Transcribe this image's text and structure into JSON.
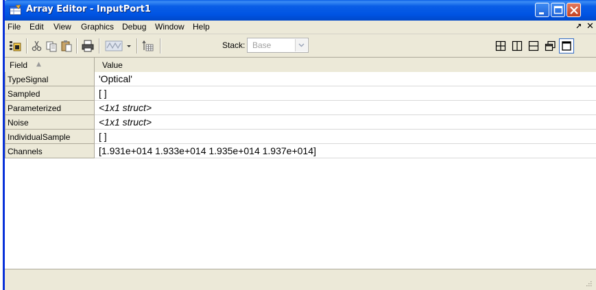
{
  "window": {
    "title": "Array Editor - InputPort1"
  },
  "menu": {
    "items": [
      "File",
      "Edit",
      "View",
      "Graphics",
      "Debug",
      "Window",
      "Help"
    ],
    "undock_glyph": "↗",
    "close_glyph": "✕"
  },
  "toolbar": {
    "stack_label": "Stack:",
    "stack_value": "Base",
    "icons": [
      "import-data-icon",
      "cut-icon",
      "copy-icon",
      "paste-icon",
      "print-icon",
      "plot-icon",
      "plot-dropdown-icon",
      "up-one-level-icon"
    ],
    "layout_icons": [
      "tile-icon",
      "left-right-split-icon",
      "top-bottom-split-icon",
      "float-icon",
      "maximize-icon"
    ]
  },
  "grid": {
    "headers": {
      "field": "Field",
      "value": "Value",
      "sort_glyph": "▲"
    },
    "rows": [
      {
        "field": "TypeSignal",
        "value": "'Optical'",
        "italic": false
      },
      {
        "field": "Sampled",
        "value": "[ ]",
        "italic": false
      },
      {
        "field": "Parameterized",
        "value": "<1x1 struct>",
        "italic": true
      },
      {
        "field": "Noise",
        "value": "<1x1 struct>",
        "italic": true
      },
      {
        "field": "IndividualSample",
        "value": "[ ]",
        "italic": false
      },
      {
        "field": "Channels",
        "value": "[1.931e+014 1.933e+014 1.935e+014 1.937e+014]",
        "italic": false
      }
    ]
  },
  "colors": {
    "titlebar": "#0054e3",
    "chrome": "#ece9d8",
    "border": "#aca899"
  }
}
